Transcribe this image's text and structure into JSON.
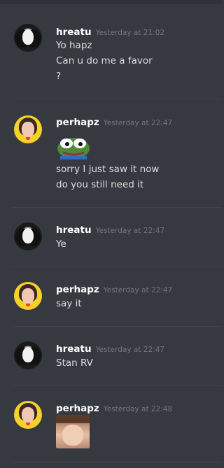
{
  "messages": [
    {
      "username": "hreatu",
      "timestamp": "Yesterday at 21:02",
      "avatar": "bw-portrait-avatar",
      "lines": [
        "Yo hapz",
        "Can u do me a favor",
        "?"
      ]
    },
    {
      "username": "perhapz",
      "timestamp": "Yesterday at 22:47",
      "avatar": "yellow-portrait-avatar",
      "attachment": "pepe-frog-emoji",
      "lines": [
        "sorry I just saw it now",
        "do you still need it"
      ]
    },
    {
      "username": "hreatu",
      "timestamp": "Yesterday at 22:47",
      "avatar": "bw-portrait-avatar",
      "lines": [
        "Ye"
      ]
    },
    {
      "username": "perhapz",
      "timestamp": "Yesterday at 22:47",
      "avatar": "yellow-portrait-avatar",
      "lines": [
        "say it"
      ]
    },
    {
      "username": "hreatu",
      "timestamp": "Yesterday at 22:47",
      "avatar": "bw-portrait-avatar",
      "lines": [
        "Stan RV"
      ]
    },
    {
      "username": "perhapz",
      "timestamp": "Yesterday at 22:48",
      "avatar": "yellow-portrait-avatar",
      "attachment": "face-photo-image",
      "lines": []
    }
  ],
  "colors": {
    "background": "#36393f",
    "username": "#ffffff",
    "message_text": "#dcddde",
    "timestamp": "#72767d",
    "divider": "#40434a"
  }
}
